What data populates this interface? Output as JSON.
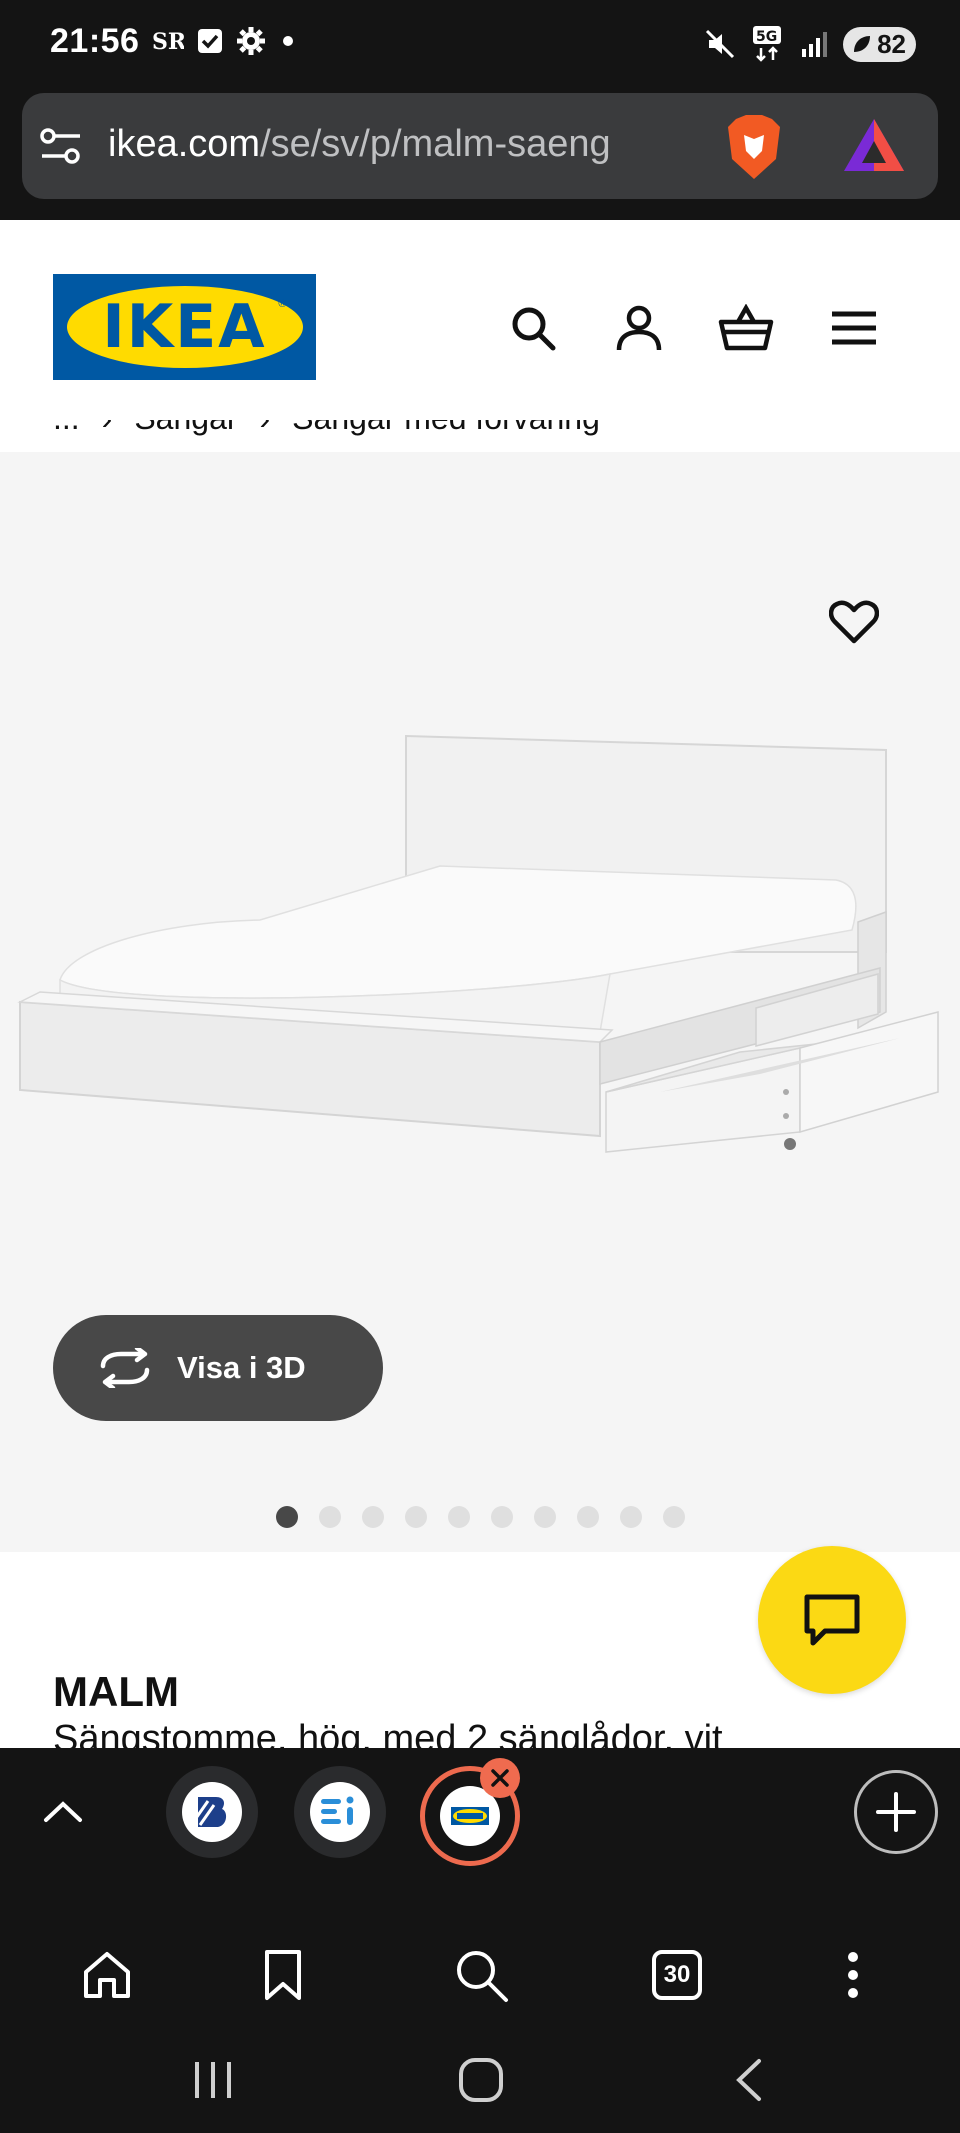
{
  "status_bar": {
    "time": "21:56",
    "battery": "82",
    "network": "5G"
  },
  "browser": {
    "url_host": "ikea.com",
    "url_path": "/se/sv/p/malm-saeng"
  },
  "header": {
    "logo_text": "IKEA"
  },
  "breadcrumb": {
    "items": [
      "...",
      "Sängar",
      "Sängar med förvaring"
    ]
  },
  "product": {
    "view_3d_label": "Visa i 3D",
    "name": "MALM",
    "description": "Sängstomme, hög, med 2 sänglådor, vit",
    "image_count": 10,
    "active_image": 1
  },
  "tabs": {
    "tab_count": "30"
  },
  "colors": {
    "ikea_blue": "#0058a3",
    "ikea_yellow": "#ffdb00",
    "chat_yellow": "#fbd914",
    "active_tab_ring": "#ed6a4e"
  }
}
